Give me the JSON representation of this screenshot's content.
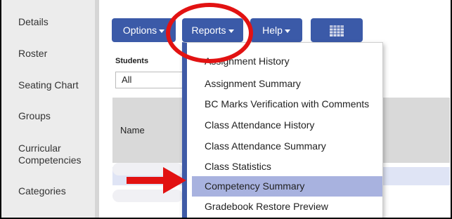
{
  "sidebar": {
    "items": [
      {
        "label": "Details"
      },
      {
        "label": "Roster"
      },
      {
        "label": "Seating Chart"
      },
      {
        "label": "Groups"
      },
      {
        "label": "Curricular Competencies"
      },
      {
        "label": "Categories"
      }
    ]
  },
  "toolbar": {
    "options_label": "Options",
    "reports_label": "Reports",
    "help_label": "Help",
    "grid_icon": "grid-view-icon"
  },
  "filter": {
    "students_label": "Students",
    "students_value": "All"
  },
  "table": {
    "name_header": "Name"
  },
  "reports_menu": {
    "items": [
      {
        "label": "Assignment History"
      },
      {
        "label": "Assignment Summary"
      },
      {
        "label": "BC Marks Verification with Comments"
      },
      {
        "label": "Class Attendance History"
      },
      {
        "label": "Class Attendance Summary"
      },
      {
        "label": "Class Statistics"
      },
      {
        "label": "Competency Summary"
      },
      {
        "label": "Gradebook Restore Preview"
      }
    ],
    "highlighted_item": "Competency Summary"
  },
  "annotation": {
    "color": "#e21212"
  },
  "colors": {
    "button": "#3b5aa8",
    "highlight": "#a8b2df",
    "sidebar": "#ececec"
  }
}
